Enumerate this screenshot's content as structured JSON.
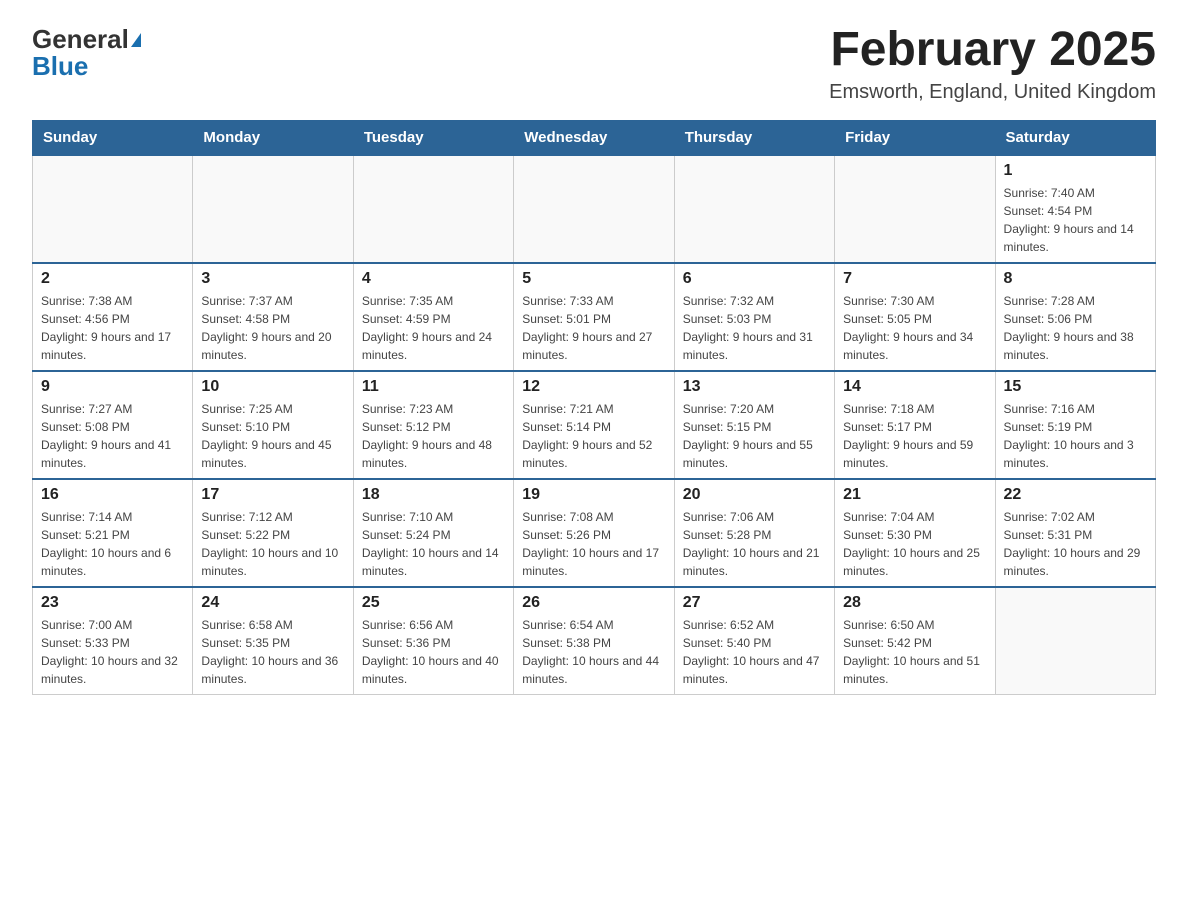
{
  "header": {
    "logo_main": "General",
    "logo_blue": "Blue",
    "title": "February 2025",
    "subtitle": "Emsworth, England, United Kingdom"
  },
  "days_of_week": [
    "Sunday",
    "Monday",
    "Tuesday",
    "Wednesday",
    "Thursday",
    "Friday",
    "Saturday"
  ],
  "weeks": [
    {
      "days": [
        {
          "number": "",
          "info": "",
          "empty": true
        },
        {
          "number": "",
          "info": "",
          "empty": true
        },
        {
          "number": "",
          "info": "",
          "empty": true
        },
        {
          "number": "",
          "info": "",
          "empty": true
        },
        {
          "number": "",
          "info": "",
          "empty": true
        },
        {
          "number": "",
          "info": "",
          "empty": true
        },
        {
          "number": "1",
          "info": "Sunrise: 7:40 AM\nSunset: 4:54 PM\nDaylight: 9 hours and 14 minutes.",
          "empty": false
        }
      ]
    },
    {
      "days": [
        {
          "number": "2",
          "info": "Sunrise: 7:38 AM\nSunset: 4:56 PM\nDaylight: 9 hours and 17 minutes.",
          "empty": false
        },
        {
          "number": "3",
          "info": "Sunrise: 7:37 AM\nSunset: 4:58 PM\nDaylight: 9 hours and 20 minutes.",
          "empty": false
        },
        {
          "number": "4",
          "info": "Sunrise: 7:35 AM\nSunset: 4:59 PM\nDaylight: 9 hours and 24 minutes.",
          "empty": false
        },
        {
          "number": "5",
          "info": "Sunrise: 7:33 AM\nSunset: 5:01 PM\nDaylight: 9 hours and 27 minutes.",
          "empty": false
        },
        {
          "number": "6",
          "info": "Sunrise: 7:32 AM\nSunset: 5:03 PM\nDaylight: 9 hours and 31 minutes.",
          "empty": false
        },
        {
          "number": "7",
          "info": "Sunrise: 7:30 AM\nSunset: 5:05 PM\nDaylight: 9 hours and 34 minutes.",
          "empty": false
        },
        {
          "number": "8",
          "info": "Sunrise: 7:28 AM\nSunset: 5:06 PM\nDaylight: 9 hours and 38 minutes.",
          "empty": false
        }
      ]
    },
    {
      "days": [
        {
          "number": "9",
          "info": "Sunrise: 7:27 AM\nSunset: 5:08 PM\nDaylight: 9 hours and 41 minutes.",
          "empty": false
        },
        {
          "number": "10",
          "info": "Sunrise: 7:25 AM\nSunset: 5:10 PM\nDaylight: 9 hours and 45 minutes.",
          "empty": false
        },
        {
          "number": "11",
          "info": "Sunrise: 7:23 AM\nSunset: 5:12 PM\nDaylight: 9 hours and 48 minutes.",
          "empty": false
        },
        {
          "number": "12",
          "info": "Sunrise: 7:21 AM\nSunset: 5:14 PM\nDaylight: 9 hours and 52 minutes.",
          "empty": false
        },
        {
          "number": "13",
          "info": "Sunrise: 7:20 AM\nSunset: 5:15 PM\nDaylight: 9 hours and 55 minutes.",
          "empty": false
        },
        {
          "number": "14",
          "info": "Sunrise: 7:18 AM\nSunset: 5:17 PM\nDaylight: 9 hours and 59 minutes.",
          "empty": false
        },
        {
          "number": "15",
          "info": "Sunrise: 7:16 AM\nSunset: 5:19 PM\nDaylight: 10 hours and 3 minutes.",
          "empty": false
        }
      ]
    },
    {
      "days": [
        {
          "number": "16",
          "info": "Sunrise: 7:14 AM\nSunset: 5:21 PM\nDaylight: 10 hours and 6 minutes.",
          "empty": false
        },
        {
          "number": "17",
          "info": "Sunrise: 7:12 AM\nSunset: 5:22 PM\nDaylight: 10 hours and 10 minutes.",
          "empty": false
        },
        {
          "number": "18",
          "info": "Sunrise: 7:10 AM\nSunset: 5:24 PM\nDaylight: 10 hours and 14 minutes.",
          "empty": false
        },
        {
          "number": "19",
          "info": "Sunrise: 7:08 AM\nSunset: 5:26 PM\nDaylight: 10 hours and 17 minutes.",
          "empty": false
        },
        {
          "number": "20",
          "info": "Sunrise: 7:06 AM\nSunset: 5:28 PM\nDaylight: 10 hours and 21 minutes.",
          "empty": false
        },
        {
          "number": "21",
          "info": "Sunrise: 7:04 AM\nSunset: 5:30 PM\nDaylight: 10 hours and 25 minutes.",
          "empty": false
        },
        {
          "number": "22",
          "info": "Sunrise: 7:02 AM\nSunset: 5:31 PM\nDaylight: 10 hours and 29 minutes.",
          "empty": false
        }
      ]
    },
    {
      "days": [
        {
          "number": "23",
          "info": "Sunrise: 7:00 AM\nSunset: 5:33 PM\nDaylight: 10 hours and 32 minutes.",
          "empty": false
        },
        {
          "number": "24",
          "info": "Sunrise: 6:58 AM\nSunset: 5:35 PM\nDaylight: 10 hours and 36 minutes.",
          "empty": false
        },
        {
          "number": "25",
          "info": "Sunrise: 6:56 AM\nSunset: 5:36 PM\nDaylight: 10 hours and 40 minutes.",
          "empty": false
        },
        {
          "number": "26",
          "info": "Sunrise: 6:54 AM\nSunset: 5:38 PM\nDaylight: 10 hours and 44 minutes.",
          "empty": false
        },
        {
          "number": "27",
          "info": "Sunrise: 6:52 AM\nSunset: 5:40 PM\nDaylight: 10 hours and 47 minutes.",
          "empty": false
        },
        {
          "number": "28",
          "info": "Sunrise: 6:50 AM\nSunset: 5:42 PM\nDaylight: 10 hours and 51 minutes.",
          "empty": false
        },
        {
          "number": "",
          "info": "",
          "empty": true
        }
      ]
    }
  ]
}
